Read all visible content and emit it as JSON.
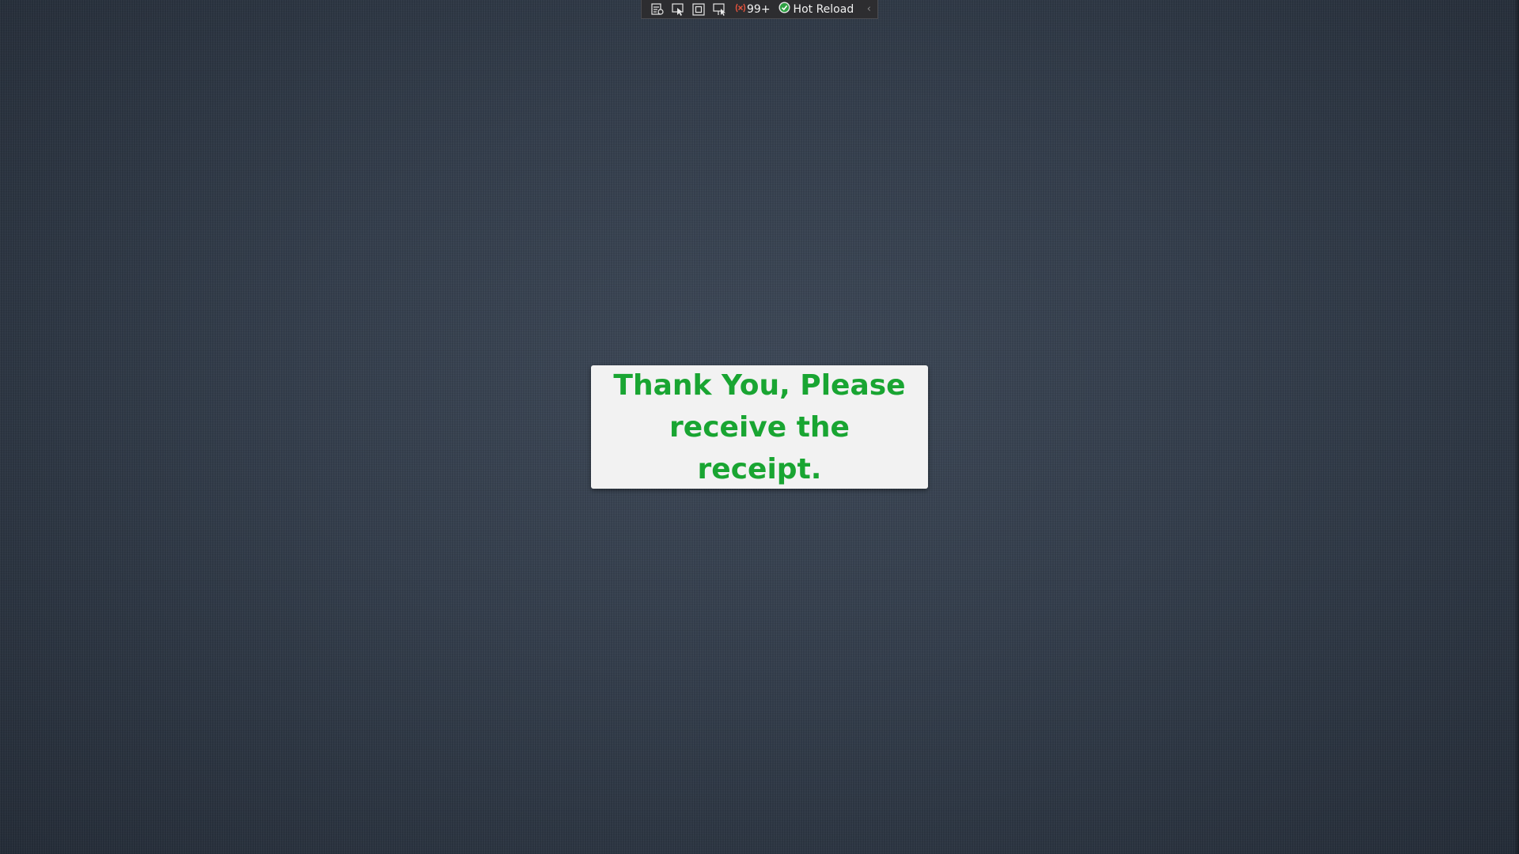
{
  "debug_toolbar": {
    "buttons": [
      {
        "icon": "live-visual-tree-icon"
      },
      {
        "icon": "select-element-icon"
      },
      {
        "icon": "display-layout-adorners-icon"
      },
      {
        "icon": "track-focus-icon"
      }
    ],
    "binding_failures_icon": "binding-failures-icon",
    "binding_failures_count": "99+",
    "hot_reload_status_icon": "check-circle-icon",
    "hot_reload_label": "Hot Reload",
    "collapse_glyph": "‹"
  },
  "message": {
    "text": "Thank You, Please receive the receipt."
  },
  "colors": {
    "message_text": "#19a532",
    "card_background": "#f2f2f2",
    "page_background": "#36414f",
    "hot_reload_ok": "#2ea043",
    "binding_failure": "#e5533d"
  }
}
